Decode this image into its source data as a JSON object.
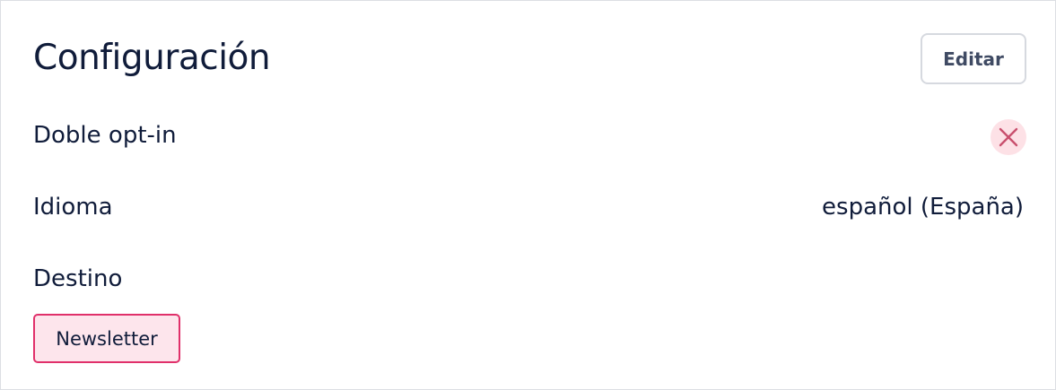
{
  "header": {
    "title": "Configuración",
    "edit_label": "Editar"
  },
  "settings": {
    "double_optin": {
      "label": "Doble opt-in",
      "enabled": false,
      "icon": "x-icon"
    },
    "language": {
      "label": "Idioma",
      "value": "español (España)"
    },
    "destination": {
      "label": "Destino",
      "tags": [
        "Newsletter"
      ]
    }
  },
  "colors": {
    "text": "#101c3a",
    "disabled_icon": "#c9506e",
    "disabled_bg": "#fde1e6",
    "tag_border": "#e0306a",
    "tag_bg": "#fde5ec"
  }
}
